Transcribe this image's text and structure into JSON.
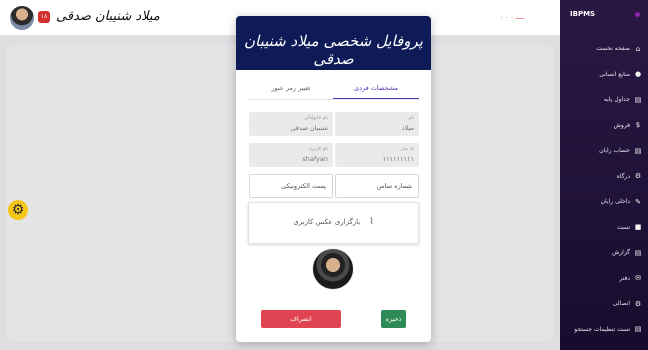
{
  "topbar": {
    "user_name": "میلاد شنیبان صدقی",
    "badge": "۱۸",
    "status": "ـــــ ۰ ۰ ۰"
  },
  "sidebar": {
    "brand": "IBPMS",
    "items": [
      {
        "label": "صفحه نخست",
        "icon": "home-icon"
      },
      {
        "label": "منابع انسانی",
        "icon": "user-icon"
      },
      {
        "label": "جداول پایه",
        "icon": "file-icon"
      },
      {
        "label": "فروش",
        "icon": "dollar-icon"
      },
      {
        "label": "حساب رایان",
        "icon": "file-icon"
      },
      {
        "label": "درگاه",
        "icon": "gear-icon"
      },
      {
        "label": "داخلی رایان",
        "icon": "wrench-icon"
      },
      {
        "label": "تست",
        "icon": "lock-icon"
      },
      {
        "label": "گزارش",
        "icon": "file-icon"
      },
      {
        "label": "دفتر",
        "icon": "mail-icon"
      },
      {
        "label": "اتصالی",
        "icon": "gear-icon"
      },
      {
        "label": "تست تنظیمات جستجو",
        "icon": "file-icon"
      }
    ]
  },
  "modal": {
    "title": "پروفایل شخصی میلاد شنیبان صدقی",
    "tabs": {
      "personal": "مشخصات فردی",
      "password": "تغییر رمز عبور"
    },
    "fields": {
      "first_name": {
        "label": "نام",
        "value": "میلاد"
      },
      "last_name": {
        "label": "نام خانوادگی",
        "value": "شنیبان صدقی"
      },
      "national_code": {
        "label": "کد ملی",
        "value": "۱۱۱۱۱۱۱۱۱"
      },
      "username": {
        "label": "نام کاربری",
        "value": "shafyan"
      },
      "phone": {
        "placeholder": "شماره تماس"
      },
      "email": {
        "placeholder": "پست الکترونیکی"
      }
    },
    "upload_label": "بارگزاری عکس کاربری",
    "save_label": "ذخیره",
    "cancel_label": "انصراف"
  },
  "colors": {
    "sidebar_bg": "#1f1238",
    "modal_header": "#0f1b57",
    "save": "#2e8b57",
    "cancel": "#e04452",
    "accent": "#5e35b1",
    "fab": "#f5c518"
  }
}
